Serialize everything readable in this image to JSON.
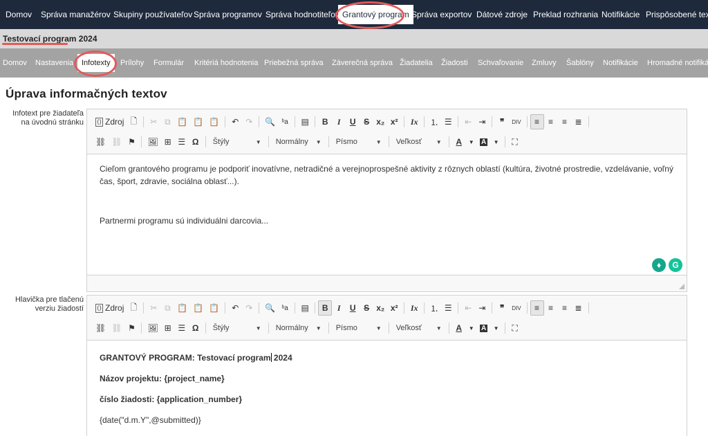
{
  "topnav": {
    "items": [
      "Domov",
      "Správa manažérov",
      "Skupiny používateľov",
      "Správa programov",
      "Správa hodnotiteľov",
      "Grantový program",
      "Správa exportov",
      "Dátové zdroje",
      "Preklad rozhrania",
      "Notifikácie",
      "Prispôsobené texty"
    ],
    "active": "Grantový program"
  },
  "program": {
    "title": "Testovací program 2024"
  },
  "subnav": {
    "items": [
      "Domov",
      "Nastavenia",
      "Infotexty",
      "Prílohy",
      "Formulár",
      "Kritériá hodnotenia",
      "Priebežná správa",
      "Záverečná správa",
      "Žiadatelia",
      "Žiadosti",
      "Schvaľovanie",
      "Zmluvy",
      "Šablóny",
      "Notifikácie",
      "Hromadné notifikácie"
    ],
    "active": "Infotexty"
  },
  "page": {
    "title": "Úprava informačných textov"
  },
  "toolbar": {
    "source_label": "Zdroj",
    "styles_label": "Štýly",
    "format_label": "Normálny",
    "font_label": "Písmo",
    "size_label": "Veľkosť",
    "bold": "B",
    "italic": "I",
    "underline": "U",
    "strike": "S",
    "subscript": "x₂",
    "superscript": "x²",
    "removeformat": "Ix",
    "omega": "Ω",
    "quote": "❞",
    "undo": "↶",
    "redo": "↷",
    "text_color": "A",
    "bg_color": "A"
  },
  "editors": [
    {
      "label": "Infotext pre žiadateľa na úvodnú stránku",
      "paragraphs": [
        "Cieľom grantového programu je podporiť inovatívne, netradičné a verejnoprospešné aktivity z rôznych oblastí  (kultúra, životné prostredie, vzdelávanie, voľný čas, šport, zdravie, sociálna oblasť...).",
        "Partnermi programu sú individuálni darcovia..."
      ]
    },
    {
      "label": "Hlavička pre tlačenú verziu žiadostí",
      "lines": {
        "line1_prefix": "GRANTOVÝ PROGRAM: Testovací program",
        "line1_suffix": " 2024",
        "line2": "Názov projektu: {project_name}",
        "line3": "číslo žiadosti: {application_number}",
        "line4": "{date(\"d.m.Y\",@submitted)}"
      }
    }
  ],
  "colors": {
    "topnav_bg": "#1e2a3c",
    "subnav_bg": "#a3a3a3",
    "program_bar_bg": "#d9d9d9",
    "annotation": "#e25a5a",
    "grammarly": "#15c39a"
  }
}
